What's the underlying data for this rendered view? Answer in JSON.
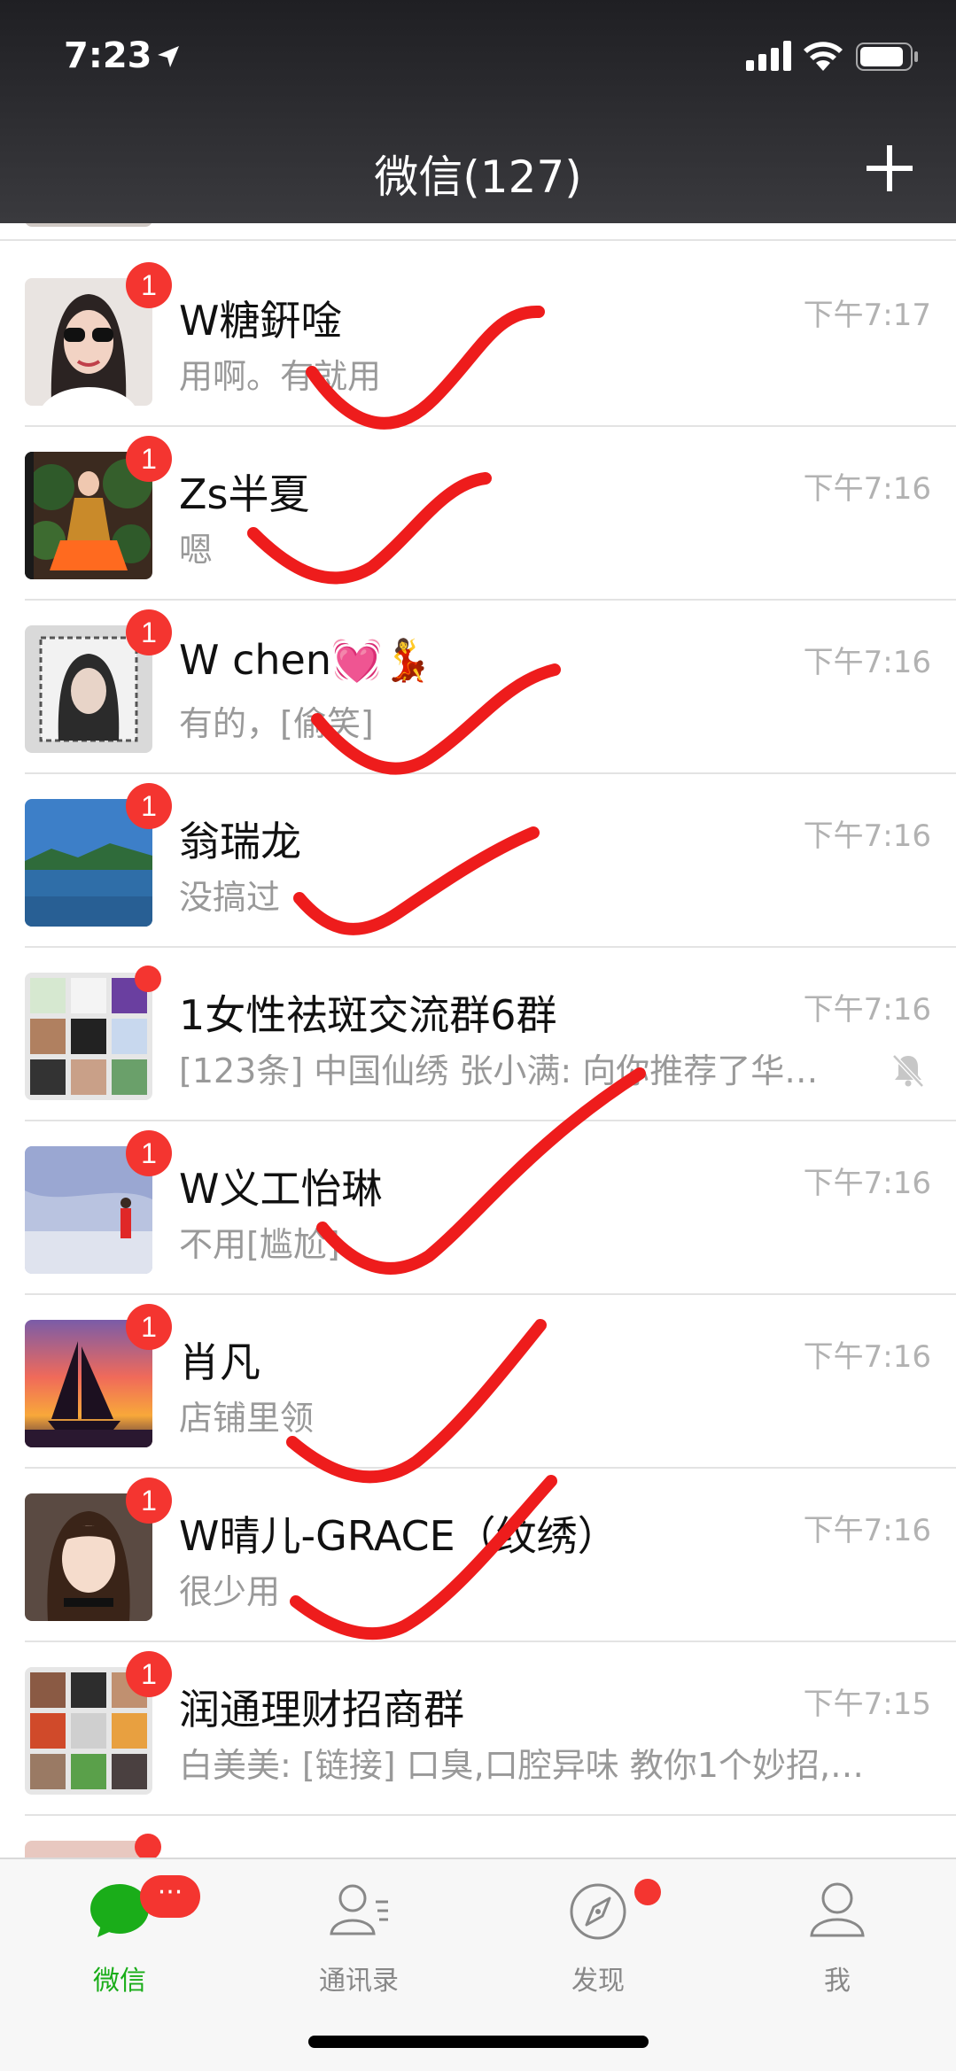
{
  "status_bar": {
    "time": "7:23"
  },
  "header": {
    "title": "微信(127)"
  },
  "chats": [
    {
      "name": "W糖銒唫",
      "message": "用啊。有就用",
      "time": "下午7:17",
      "badge": "1"
    },
    {
      "name": "Zs半夏",
      "message": "嗯",
      "time": "下午7:16",
      "badge": "1"
    },
    {
      "name": "W chen💓💃",
      "message": "有的，[偷笑]",
      "time": "下午7:16",
      "badge": "1"
    },
    {
      "name": "翁瑞龙",
      "message": "没搞过",
      "time": "下午7:16",
      "badge": "1"
    },
    {
      "name": "1女性祛斑交流群6群",
      "message": "[123条] 中国仙绣 张小满: 向你推荐了华…",
      "time": "下午7:16",
      "muted": true
    },
    {
      "name": "W义工怡琳",
      "message": "不用[尴尬]",
      "time": "下午7:16",
      "badge": "1"
    },
    {
      "name": "肖凡",
      "message": "店铺里领",
      "time": "下午7:16",
      "badge": "1"
    },
    {
      "name": "W晴儿-GRACE（纹绣）",
      "message": "很少用",
      "time": "下午7:16",
      "badge": "1"
    },
    {
      "name": "润通理财招商群",
      "message": "白美美: [链接] 口臭,口腔异味 教你1个妙招,…",
      "time": "下午7:15",
      "badge": "1"
    }
  ],
  "tabbar": {
    "chats": {
      "label": "微信",
      "badge": "···"
    },
    "contacts": {
      "label": "通讯录"
    },
    "discover": {
      "label": "发现"
    },
    "me": {
      "label": "我"
    }
  },
  "colors": {
    "accent": "#1aad19",
    "badge": "#f43530",
    "check_mark": "#ee1c1c"
  }
}
